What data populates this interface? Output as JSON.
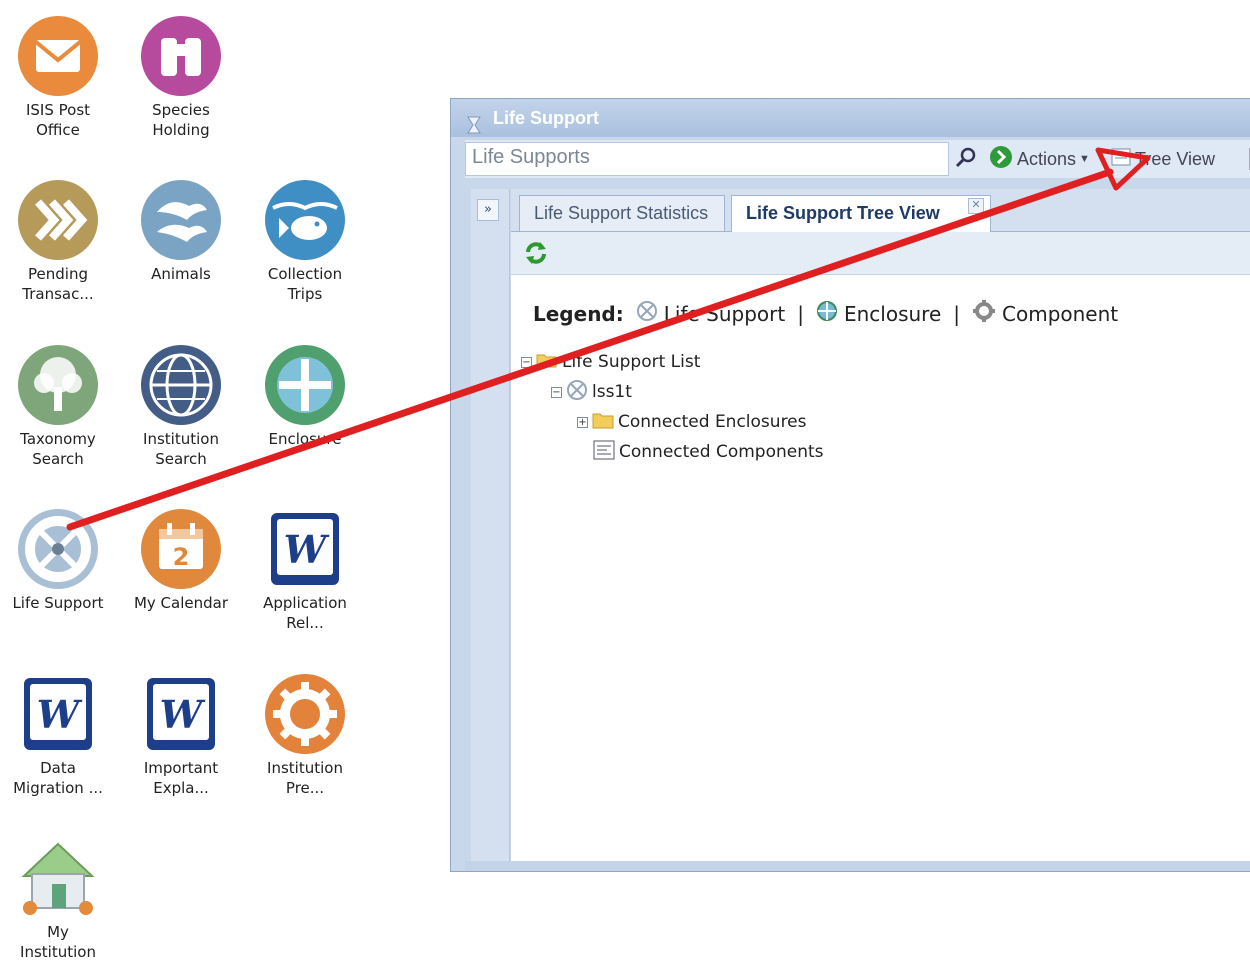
{
  "desktop": {
    "icons": [
      {
        "label": "ISIS Post\nOffice",
        "icon": "envelope-icon"
      },
      {
        "label": "Species\nHolding",
        "icon": "binoculars-icon"
      },
      {
        "label": "Pending\nTransac...",
        "icon": "forward-arrows-icon"
      },
      {
        "label": "Animals",
        "icon": "animals-icon"
      },
      {
        "label": "Collection\nTrips",
        "icon": "fish-icon"
      },
      {
        "label": "Taxonomy\nSearch",
        "icon": "tree-icon"
      },
      {
        "label": "Institution\nSearch",
        "icon": "globe-icon"
      },
      {
        "label": "Enclosure",
        "icon": "enclosure-icon"
      },
      {
        "label": "Life Support",
        "icon": "life-support-icon"
      },
      {
        "label": "My Calendar",
        "icon": "calendar-icon",
        "day": "2"
      },
      {
        "label": "Application\nRel...",
        "icon": "word-doc-icon"
      },
      {
        "label": "Data\nMigration ...",
        "icon": "word-doc-icon"
      },
      {
        "label": "Important\nExpla...",
        "icon": "word-doc-icon"
      },
      {
        "label": "Institution\nPre...",
        "icon": "gear-icon"
      },
      {
        "label": "My\nInstitution",
        "icon": "house-icon"
      }
    ]
  },
  "window": {
    "title": "Life Support",
    "search_placeholder": "Life Supports",
    "actions_label": "Actions",
    "tree_view_label": "Tree View",
    "collapse_label": "»",
    "tabs": [
      {
        "label": "Life Support Statistics",
        "active": false
      },
      {
        "label": "Life Support Tree View",
        "active": true
      }
    ],
    "legend": {
      "heading": "Legend:",
      "items": [
        "Life Support",
        "Enclosure",
        "Component"
      ],
      "separator": "|"
    },
    "tree": {
      "root": "Life Support List",
      "node": "lss1t",
      "children": [
        "Connected Enclosures",
        "Connected Components"
      ]
    }
  },
  "annotation": {
    "color": "#e02020"
  }
}
